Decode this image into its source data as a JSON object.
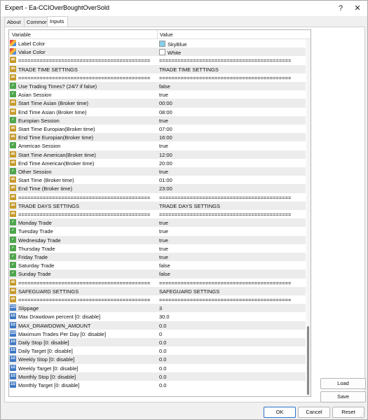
{
  "window": {
    "title": "Expert - Ea-CCIOverBoughtOverSold",
    "help": "?",
    "close": "✕"
  },
  "tabs": [
    {
      "label": "About"
    },
    {
      "label": "Common"
    },
    {
      "label": "Inputs"
    }
  ],
  "grid": {
    "col_variable": "Variable",
    "col_value": "Value",
    "rows": [
      {
        "icon": "col",
        "var": "Label Color",
        "val": "SkyBlue",
        "swatch": "#87ceeb"
      },
      {
        "icon": "col",
        "var": "Value Color",
        "val": "White",
        "swatch": "#ffffff"
      },
      {
        "icon": "ab",
        "var": "===========================================",
        "val": "==========================================="
      },
      {
        "icon": "ab",
        "var": "TRADE TIME SETTINGS",
        "val": "TRADE TIME SETTINGS"
      },
      {
        "icon": "ab",
        "var": "===========================================",
        "val": "==========================================="
      },
      {
        "icon": "bool",
        "var": "Use Trading Times? (24/7 if false)",
        "val": "false"
      },
      {
        "icon": "bool",
        "var": "Asian Session",
        "val": "true"
      },
      {
        "icon": "ab",
        "var": "Start Time Asian (Broker time)",
        "val": "00:00"
      },
      {
        "icon": "ab",
        "var": "End Time Asian (Broker time)",
        "val": "08:00"
      },
      {
        "icon": "bool",
        "var": "Europian Session",
        "val": "true"
      },
      {
        "icon": "ab",
        "var": "Start Time Europian(Broker time)",
        "val": "07:00"
      },
      {
        "icon": "ab",
        "var": "End Time Europian(Broker time)",
        "val": "16:00"
      },
      {
        "icon": "bool",
        "var": "American Session",
        "val": "true"
      },
      {
        "icon": "ab",
        "var": "Start Time American(Broker time)",
        "val": "12:00"
      },
      {
        "icon": "ab",
        "var": "End Time American(Broker time)",
        "val": "20:00"
      },
      {
        "icon": "bool",
        "var": "Other Session",
        "val": "true"
      },
      {
        "icon": "ab",
        "var": "Start Time (Broker time)",
        "val": "01:00"
      },
      {
        "icon": "ab",
        "var": "End Time (Broker time)",
        "val": "23:00"
      },
      {
        "icon": "ab",
        "var": "===========================================",
        "val": "==========================================="
      },
      {
        "icon": "ab",
        "var": "TRADE DAYS SETTINGS",
        "val": "TRADE DAYS SETTINGS"
      },
      {
        "icon": "ab",
        "var": "===========================================",
        "val": "==========================================="
      },
      {
        "icon": "bool",
        "var": "Monday Trade",
        "val": "true"
      },
      {
        "icon": "bool",
        "var": "Tuesday Trade",
        "val": "true"
      },
      {
        "icon": "bool",
        "var": "Wednesday Trade",
        "val": "true"
      },
      {
        "icon": "bool",
        "var": "Thursday Trade",
        "val": "true"
      },
      {
        "icon": "bool",
        "var": "Friday Trade",
        "val": "true"
      },
      {
        "icon": "bool",
        "var": "Saturday Trade",
        "val": "false"
      },
      {
        "icon": "bool",
        "var": "Sunday Trade",
        "val": "false"
      },
      {
        "icon": "ab",
        "var": "===========================================",
        "val": "==========================================="
      },
      {
        "icon": "ab",
        "var": "SAFEGUARD SETTINGS",
        "val": "SAFEGUARD SETTINGS"
      },
      {
        "icon": "ab",
        "var": "===========================================",
        "val": "==========================================="
      },
      {
        "icon": "num",
        "var": "Slippage",
        "val": "3"
      },
      {
        "icon": "dbl",
        "var": "Max Drawdown percent [0: disable]",
        "val": "30.0"
      },
      {
        "icon": "dbl",
        "var": "MAX_DRAWDOWN_AMOUNT",
        "val": "0.0"
      },
      {
        "icon": "num",
        "var": "Maximum Trades Per Day [0: disable]",
        "val": "0"
      },
      {
        "icon": "dbl",
        "var": "Daily Stop [0: disable]",
        "val": "0.0"
      },
      {
        "icon": "dbl",
        "var": "Daily Target [0: disable]",
        "val": "0.0"
      },
      {
        "icon": "dbl",
        "var": "Weekly Stop [0: disable]",
        "val": "0.0"
      },
      {
        "icon": "dbl",
        "var": "Weekly Target [0: disable]",
        "val": "0.0"
      },
      {
        "icon": "dbl",
        "var": "Monthly Stop [0: disable]",
        "val": "0.0"
      },
      {
        "icon": "dbl",
        "var": "Monthly Target [0: disable]",
        "val": "0.0"
      }
    ]
  },
  "side_buttons": {
    "load": "Load",
    "save": "Save"
  },
  "buttons": {
    "ok": "OK",
    "cancel": "Cancel",
    "reset": "Reset"
  }
}
